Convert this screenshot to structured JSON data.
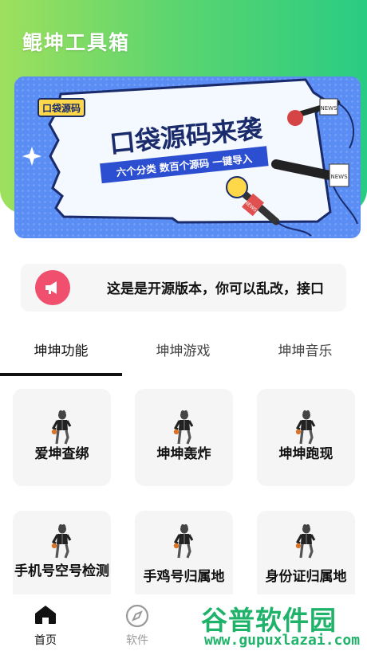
{
  "app": {
    "title": "鲲坤工具箱"
  },
  "banner": {
    "tag": "口袋源码",
    "headline": "口袋源码来袭",
    "subline": "六个分类 数百个源码 一键导入",
    "mic_label_1": "NEWS",
    "mic_label_2": "NEWS",
    "mic_label_3": "NEWS"
  },
  "notice": {
    "icon": "megaphone-icon",
    "text": "这是是开源版本，你可以乱改，接口"
  },
  "tabs": [
    {
      "label": "坤坤功能",
      "active": true
    },
    {
      "label": "坤坤游戏",
      "active": false
    },
    {
      "label": "坤坤音乐",
      "active": false
    }
  ],
  "tools": [
    {
      "label": "爱坤查绑",
      "icon": "dancer-icon"
    },
    {
      "label": "坤坤轰炸",
      "icon": "dancer-icon"
    },
    {
      "label": "坤坤跑现",
      "icon": "dancer-icon"
    },
    {
      "label": "手机号空号检测",
      "icon": "dancer-icon"
    },
    {
      "label": "手鸡号归属地",
      "icon": "dancer-icon"
    },
    {
      "label": "身份证归属地",
      "icon": "dancer-icon"
    }
  ],
  "bottom_nav": [
    {
      "label": "首页",
      "icon": "home-icon",
      "active": true
    },
    {
      "label": "软件",
      "icon": "compass-icon",
      "active": false
    }
  ],
  "watermark": {
    "brand": "谷普软件园",
    "url": "www.gupuxlazai.com"
  },
  "colors": {
    "accent": "#29cc83",
    "banner": "#5b8ef5",
    "notice_icon": "#f0506e",
    "watermark": "#1fb36a"
  }
}
